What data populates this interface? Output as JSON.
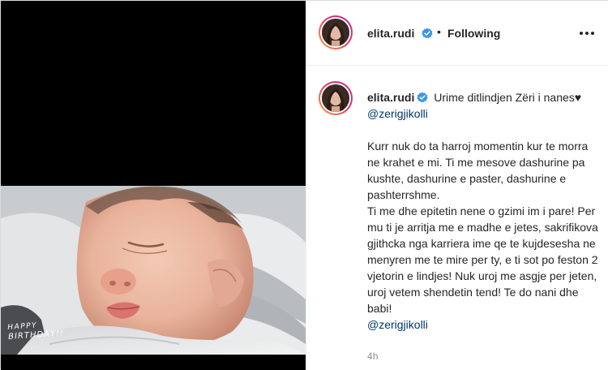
{
  "post": {
    "username": "elita.rudi",
    "follow_separator": "•",
    "follow_status": "Following",
    "image_overlay": {
      "line1": "HAPPY",
      "line2": "BIRTHDAY!!"
    }
  },
  "caption": {
    "username": "elita.rudi",
    "intro": "Urime ditlindjen Zëri i nanes",
    "heart": "♥",
    "mention_top": "@zerigjikolli",
    "body": "Kurr nuk do ta harroj momentin kur te morra ne krahet e mi. Ti me mesove dashurine pa kushte, dashurine e paster, dashurine e pashterrshme.\nTi me dhe epitetin nene o gzimi im i pare! Per mu ti je arritja me e madhe e jetes, sakrifikova gjithcka nga karriera ime qe te kujdesesha ne menyren me te mire per ty, e ti sot po feston 2 vjetorin e lindjes! Nuk uroj me asgje per jeten, uroj vetem shendetin tend! Te do nani dhe babi!",
    "mention_bottom": "@zerigjikolli",
    "timestamp": "4h"
  },
  "colors": {
    "verified_badge": "#3897f0",
    "mention": "#00376b",
    "story_ring_start": "#f9a13b",
    "story_ring_end": "#b62a9d",
    "timestamp": "#8e8e8e"
  },
  "icons": {
    "verified": "verified-badge-icon",
    "more": "more-options-icon"
  }
}
